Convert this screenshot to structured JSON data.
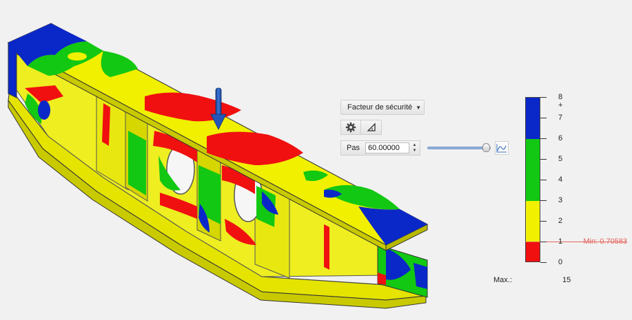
{
  "result_dropdown": {
    "label": "Facteur de sécurité",
    "caret": "▼"
  },
  "toolbar": {
    "settings_icon": "gear-icon",
    "probe_icon": "triangle-probe-icon"
  },
  "step": {
    "label": "Pas",
    "value": "60.00000",
    "slider_fraction": 1.0,
    "graph_icon": "graph-icon"
  },
  "legend": {
    "colors": {
      "blue": "#0a28c8",
      "green": "#12c812",
      "yellow": "#f0f000",
      "red": "#f01010"
    },
    "ticks": [
      {
        "label": "8 +"
      },
      {
        "label": "7"
      },
      {
        "label": "6"
      },
      {
        "label": "5"
      },
      {
        "label": "4"
      },
      {
        "label": "3"
      },
      {
        "label": "2"
      },
      {
        "label": "1"
      },
      {
        "label": "0"
      }
    ],
    "min_label": "Min: 0.70583",
    "max_label": "Max.:",
    "max_value": "15"
  },
  "model": {
    "description_icon": "load-arrow-icon",
    "load_color": "#1f55b8"
  }
}
